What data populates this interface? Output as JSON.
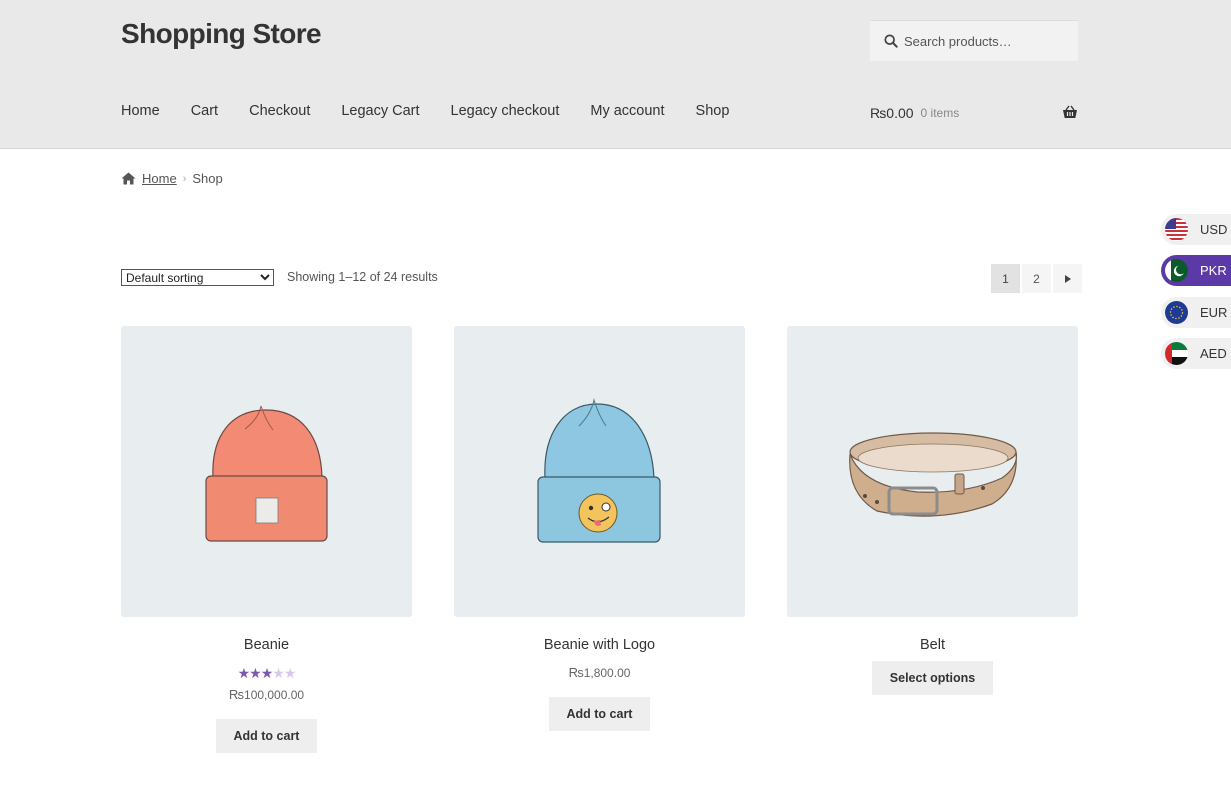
{
  "site": {
    "title": "Shopping Store"
  },
  "search": {
    "placeholder": "Search products…"
  },
  "nav": {
    "items": [
      "Home",
      "Cart",
      "Checkout",
      "Legacy Cart",
      "Legacy checkout",
      "My account",
      "Shop"
    ]
  },
  "cart": {
    "amount": "₨0.00",
    "count": "0 items"
  },
  "breadcrumb": {
    "home": "Home",
    "separator": "›",
    "current": "Shop"
  },
  "toolbar": {
    "sorting_selected": "Default sorting",
    "result_count": "Showing 1–12 of 24 results",
    "pages": [
      "1",
      "2"
    ],
    "current_page": "1"
  },
  "products": [
    {
      "title": "Beanie",
      "rating": 3.5,
      "price_symbol": "₨",
      "price_value": "100,000.00",
      "button": "Add to cart"
    },
    {
      "title": "Beanie with Logo",
      "price_symbol": "₨",
      "price_value": "1,800.00",
      "button": "Add to cart"
    },
    {
      "title": "Belt",
      "button": "Select options"
    }
  ],
  "currencies": [
    {
      "code": "USD",
      "active": false
    },
    {
      "code": "PKR",
      "active": true
    },
    {
      "code": "EUR",
      "active": false
    },
    {
      "code": "AED",
      "active": false
    }
  ],
  "colors": {
    "accent": "#7f54b3",
    "currency_active": "#5b3aa7",
    "header_bg": "#e9e9e9",
    "thumb_bg": "#e8edf0"
  }
}
